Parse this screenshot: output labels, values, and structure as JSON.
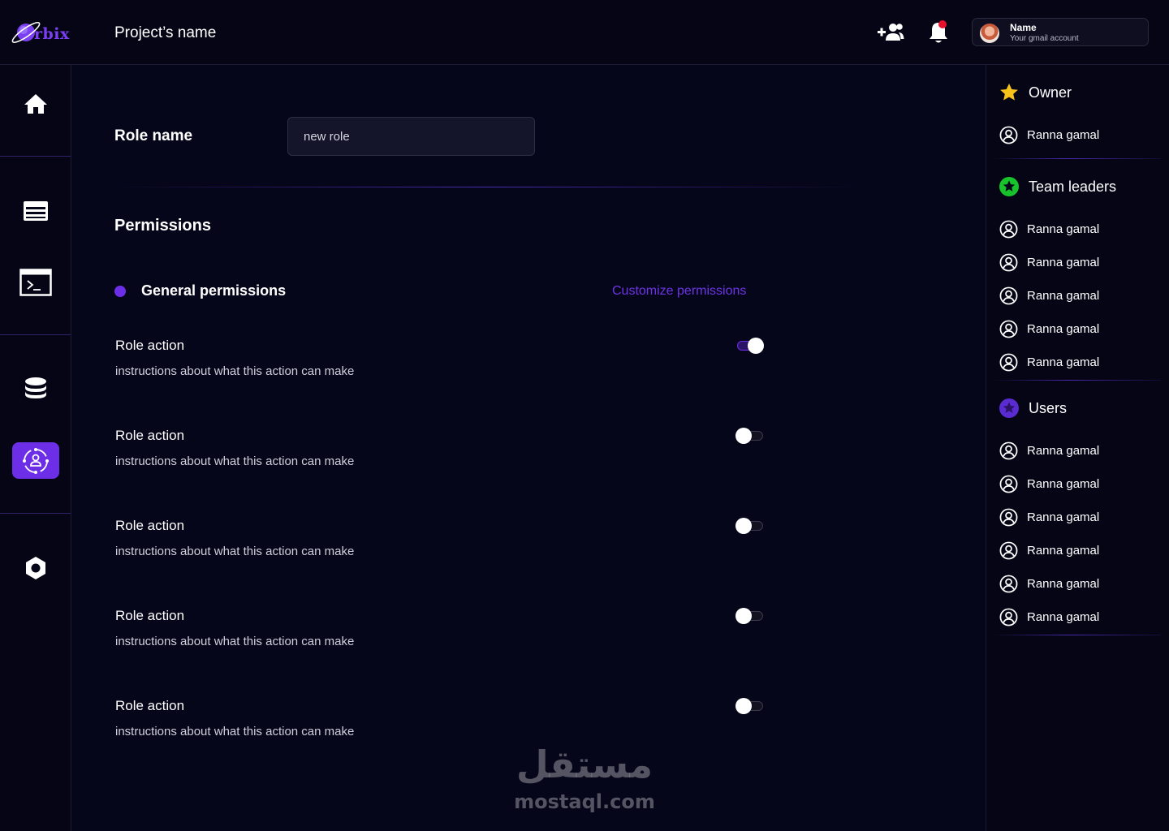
{
  "header": {
    "logo_text": "rbix",
    "project_name": "Project’s name",
    "account": {
      "name": "Name",
      "email": "Your gmail account"
    }
  },
  "sidebar": {
    "items": [
      {
        "icon": "home-icon",
        "active": false
      },
      {
        "icon": "table-icon",
        "active": false
      },
      {
        "icon": "terminal-icon",
        "active": false
      },
      {
        "icon": "database-icon",
        "active": false
      },
      {
        "icon": "roles-icon",
        "active": true
      },
      {
        "icon": "settings-icon",
        "active": false
      }
    ]
  },
  "main": {
    "role_label": "Role name",
    "role_value": "new role",
    "permissions_title": "Permissions",
    "general_title": "General permissions",
    "customize_label": "Customize permissions",
    "actions": [
      {
        "title": "Role action",
        "description": "instructions about what this action can make",
        "enabled": true
      },
      {
        "title": "Role action",
        "description": "instructions about what this action can make",
        "enabled": false
      },
      {
        "title": "Role action",
        "description": "instructions about what this action can make",
        "enabled": false
      },
      {
        "title": "Role action",
        "description": "instructions about what this action can make",
        "enabled": false
      },
      {
        "title": "Role action",
        "description": "instructions about what this action can make",
        "enabled": false
      }
    ]
  },
  "right_panel": {
    "owner": {
      "title": "Owner",
      "members": [
        "Ranna gamal"
      ]
    },
    "team_leaders": {
      "title": "Team leaders",
      "members": [
        "Ranna gamal",
        "Ranna gamal",
        "Ranna gamal",
        "Ranna gamal",
        "Ranna gamal"
      ]
    },
    "users": {
      "title": "Users",
      "members": [
        "Ranna gamal",
        "Ranna gamal",
        "Ranna gamal",
        "Ranna gamal",
        "Ranna gamal",
        "Ranna gamal"
      ]
    }
  },
  "watermark": {
    "arabic": "مستقل",
    "latin": "mostaql.com"
  },
  "colors": {
    "accent": "#6d2ee8",
    "background": "#06061a",
    "notification": "#e8112d",
    "owner_star": "#f7c21a",
    "leader_star": "#18c22b"
  }
}
